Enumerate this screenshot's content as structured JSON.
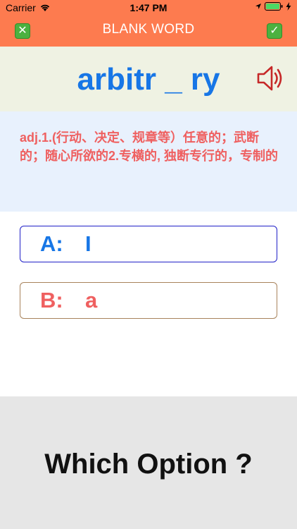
{
  "status": {
    "carrier": "Carrier",
    "time": "1:47 PM"
  },
  "nav": {
    "title": "BLANK WORD",
    "left_icon": "cross-mark-icon",
    "right_icon": "check-mark-icon",
    "accent": "#FD7B4F"
  },
  "word": {
    "text": "arbitr _ ry",
    "color": "#1776E6"
  },
  "definition": {
    "text": "adj.1.(行动、决定、规章等）任意的；武断的；随心所欲的2.专横的, 独断专行的，专制的"
  },
  "options": [
    {
      "letter": "A:",
      "value": "I"
    },
    {
      "letter": "B:",
      "value": "a"
    }
  ],
  "question": {
    "text": "Which Option ?"
  }
}
